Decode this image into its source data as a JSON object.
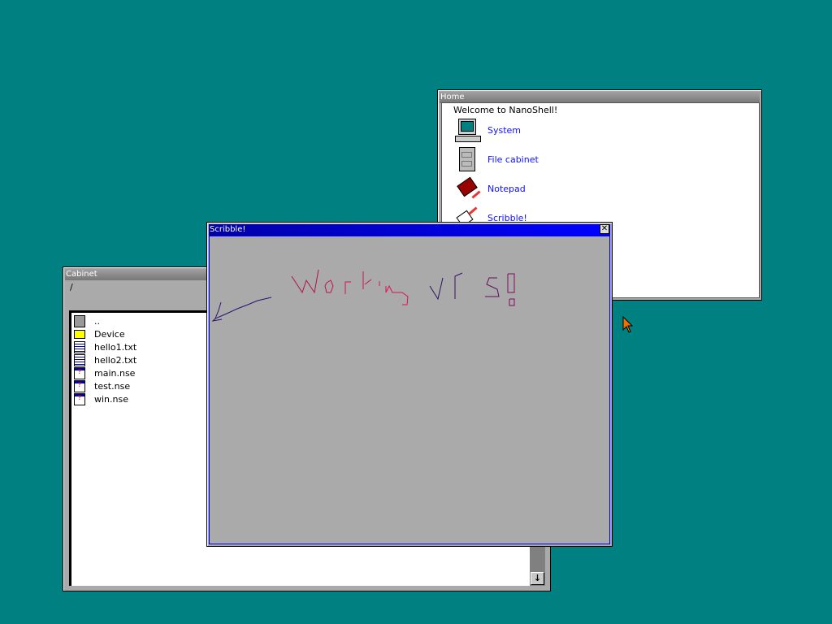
{
  "home": {
    "title": "Home",
    "welcome": "Welcome to NanoShell!",
    "apps": [
      {
        "label": "System",
        "icon": "computer-icon"
      },
      {
        "label": "File cabinet",
        "icon": "file-cabinet-icon"
      },
      {
        "label": "Notepad",
        "icon": "notepad-book-icon"
      },
      {
        "label": "Scribble!",
        "icon": "scribble-icon"
      }
    ]
  },
  "cabinet": {
    "title": "Cabinet",
    "path": "/",
    "files": [
      {
        "name": "..",
        "icon": "parent-folder-icon"
      },
      {
        "name": "Device",
        "icon": "folder-icon"
      },
      {
        "name": "hello1.txt",
        "icon": "text-file-icon"
      },
      {
        "name": "hello2.txt",
        "icon": "text-file-icon"
      },
      {
        "name": "main.nse",
        "icon": "executable-icon"
      },
      {
        "name": "test.nse",
        "icon": "executable-icon"
      },
      {
        "name": "win.nse",
        "icon": "executable-icon"
      }
    ],
    "scroll_down": "↓"
  },
  "scribble": {
    "title": "Scribble!",
    "close": "✕"
  },
  "colors": {
    "desktop": "#008080",
    "title_active": "#0000a8",
    "link": "#1010ff"
  }
}
